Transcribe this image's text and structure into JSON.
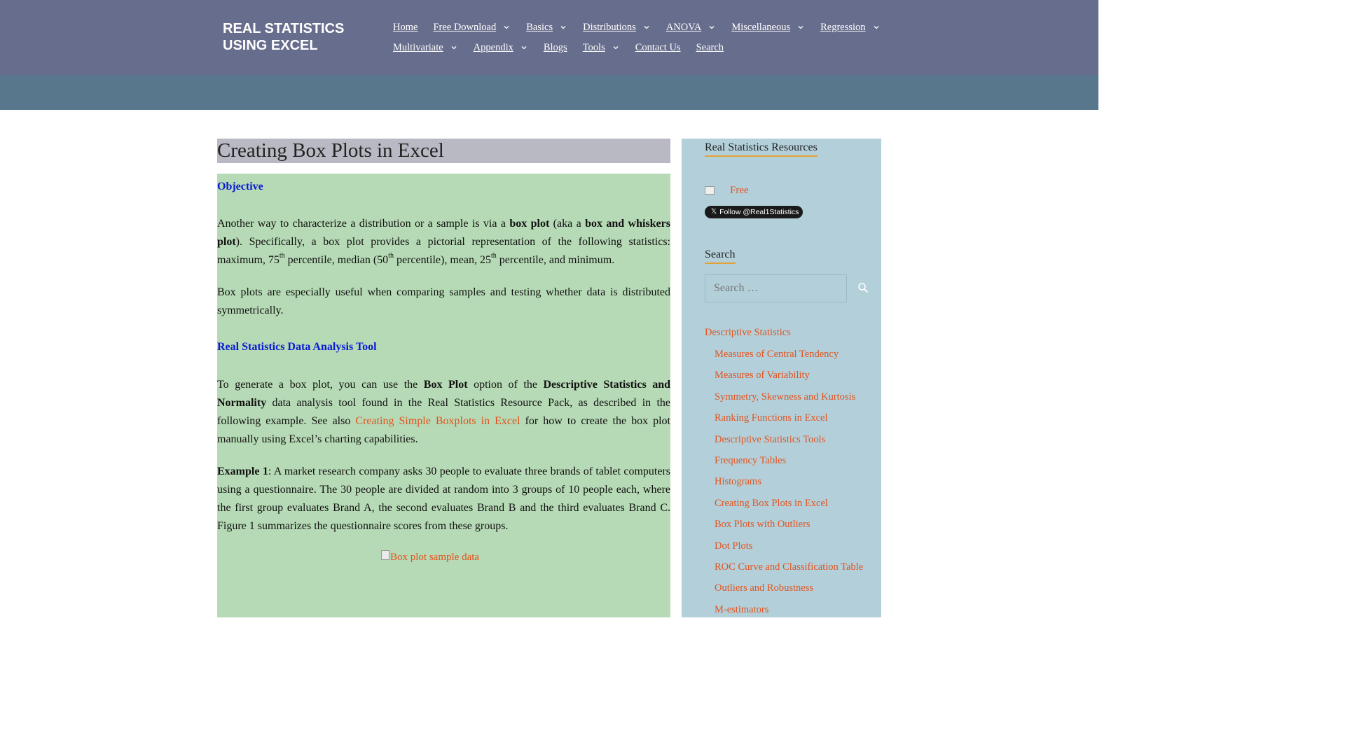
{
  "header": {
    "brand_line1": "REAL STATISTICS",
    "brand_line2": "USING EXCEL",
    "nav_row1": [
      {
        "label": "Home",
        "dropdown": false
      },
      {
        "label": "Free Download",
        "dropdown": true
      },
      {
        "label": "Basics",
        "dropdown": true
      },
      {
        "label": "Distributions",
        "dropdown": true
      },
      {
        "label": "ANOVA",
        "dropdown": true
      },
      {
        "label": "Miscellaneous",
        "dropdown": true
      },
      {
        "label": "Regression",
        "dropdown": true
      }
    ],
    "nav_row2": [
      {
        "label": "Multivariate",
        "dropdown": true
      },
      {
        "label": "Appendix",
        "dropdown": true
      },
      {
        "label": "Blogs",
        "dropdown": false
      },
      {
        "label": "Tools",
        "dropdown": true
      },
      {
        "label": "Contact Us",
        "dropdown": false
      },
      {
        "label": "Search",
        "dropdown": false
      }
    ]
  },
  "article": {
    "title": "Creating Box Plots in Excel",
    "objective_heading": "Objective",
    "p1": {
      "t1": "Another way to characterize a distribution or a sample is via a ",
      "b1": "box plot",
      "t2": " (aka a ",
      "b2": "box and whiskers plot",
      "t3": "). Specifically, a box plot provides a pictorial representation of the following statistics: maximum, 75",
      "sup1": "th",
      "t4": " percentile, median (50",
      "sup2": "th",
      "t5": " percentile), mean, 25",
      "sup3": "th",
      "t6": " percentile, and minimum."
    },
    "p2": "Box plots are especially useful when comparing samples and testing whether data is distributed symmetrically.",
    "tool_heading": "Real Statistics Data Analysis Tool",
    "p3": {
      "t1": "To generate a box plot, you can use the ",
      "b1": "Box Plot",
      "t2": " option of the ",
      "b2": "Descriptive Statistics and Normality",
      "t3": " data analysis tool found in the Real Statistics Resource Pack, as described in the following example. See also ",
      "link": "Creating Simple Boxplots in Excel",
      "t4": " for how to create the box plot manually using Excel’s charting capabilities."
    },
    "p4": {
      "b1": "Example 1",
      "t1": ": A market research company asks 30 people to evaluate three brands of tablet computers using a questionnaire. The 30 people are divided at random into 3 groups of 10 people each, where the first group evaluates Brand A, the second evaluates Brand B and the third evaluates Brand C. Figure 1 summarizes the questionnaire scores from these groups."
    },
    "image_alt": "Box plot sample data"
  },
  "sidebar": {
    "resources_title": "Real Statistics Resources",
    "free_link": "Free",
    "twitter_label": "Follow @Real1Statistics",
    "search_title": "Search",
    "search_placeholder": "Search …",
    "category": "Descriptive Statistics",
    "items": [
      "Measures of Central Tendency",
      "Measures of Variability",
      "Symmetry, Skewness and Kurtosis",
      "Ranking Functions in Excel",
      "Descriptive Statistics Tools",
      "Frequency Tables",
      "Histograms",
      "Creating Box Plots in Excel",
      "Box Plots with Outliers",
      "Dot Plots",
      "ROC Curve and Classification Table",
      "Outliers and Robustness",
      "M-estimators"
    ]
  },
  "colors": {
    "header_bg": "#676d8c",
    "banner_bg": "#58778d",
    "title_bg": "#b9b9c3",
    "content_bg": "#b6dab5",
    "sidebar_bg": "#b3d0da",
    "link": "#e2531f",
    "heading_blue": "#0a1bd6"
  }
}
